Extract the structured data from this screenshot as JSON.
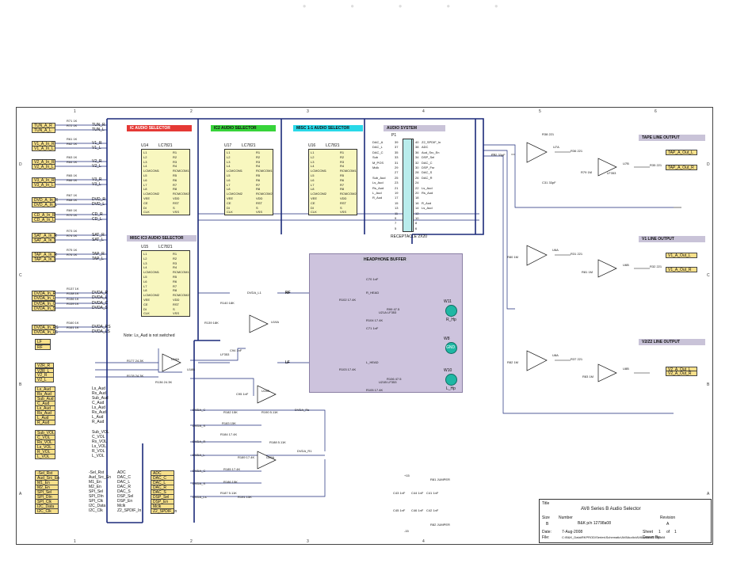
{
  "sheet": {
    "title_block": {
      "title_label": "Title",
      "title": "AV8 Series B Audio Selector",
      "size_label": "Size",
      "size": "B",
      "number_label": "Number",
      "number": "B&K p/n 12798a08",
      "revision_label": "Revision",
      "revision": "A",
      "date_label": "Date:",
      "date": "7-Aug-2008",
      "sheet_label": "Sheet",
      "sheet": "1",
      "of_label": "of",
      "of": "1",
      "file_label": "File:",
      "file": "C:\\B&K_Data\\RKPROD\\Series\\Schematic\\AV8Audio\\AV8Audio\\12798a08",
      "drawn_by_label": "Drawn By:"
    },
    "zones_top": [
      "1",
      "2",
      "3",
      "4",
      "5",
      "6"
    ],
    "zones_side": [
      "D",
      "C",
      "B",
      "A"
    ]
  },
  "blocks": {
    "ic_selector_1": "IC AUDIO SELECTOR",
    "ic_selector_2": "IC2 AUDIO SELECTOR",
    "misc_selector_1": "MISC 1-1 AUDIO SELECTOR",
    "misc_selector_2": "MISC IC3 AUDIO SELECTOR",
    "audio_system": "AUDIO SYSTEM",
    "headphone_buffer": "HEADPHONE BUFFER",
    "receptacle": "RECEPTACLE 2X20",
    "tape_line_output": "TAPE LINE OUTPUT",
    "v1_line_output": "V1 LINE OUTPUT",
    "v222_line_output": "V2/Z2 LINE OUTPUT",
    "note": "Note: Ls_Aud is not switched"
  },
  "chips": {
    "u14": {
      "ref": "U14",
      "part": "LC7821"
    },
    "u17": {
      "ref": "U17",
      "part": "LC7821"
    },
    "u16": {
      "ref": "U16",
      "part": "LC7821"
    },
    "u15": {
      "ref": "U15",
      "part": "LC7821"
    },
    "pin_rows": [
      "L1",
      "L2",
      "L3",
      "L4",
      "LCMCOM1",
      "L5",
      "L6",
      "L7",
      "L8",
      "LCMCOM2",
      "VEE",
      "CE",
      "DI",
      "CLK"
    ],
    "pin_rows_r": [
      "R1",
      "R2",
      "R3",
      "R4",
      "RCMCOM1",
      "R5",
      "R6",
      "R7",
      "R8",
      "RCMCOM2",
      "VDD",
      "RST",
      "S",
      "VSS"
    ]
  },
  "input_ports": [
    "TUN_A_R",
    "TUN_A_L",
    "V1_A_In_R",
    "V1_A_In_L",
    "V2_A_In_R",
    "V2_A_In_L",
    "V3_A_In_R",
    "V3_A_In_L",
    "DVD_A_In_R",
    "DVD_A_In_L",
    "CD_A_In_R",
    "CD_A_In_L",
    "SAT_A_In_R",
    "SAT_A_In_L",
    "TAP_A_In_R",
    "TAP_A_In_L",
    "DVDA_In_R",
    "DVDA_In_L",
    "DVDA_In_C",
    "DVDA_In_S",
    "DVDA_In_RS",
    "DVDA_In_LS"
  ],
  "input_nets": [
    "TUN_R",
    "TUN_L",
    "V1_R",
    "V1_L",
    "V2_R",
    "V2_L",
    "V3_R",
    "V3_L",
    "DVD_R",
    "DVD_L",
    "CD_R",
    "CD_L",
    "SAT_R",
    "SAT_L",
    "TAP_R",
    "TAP_L",
    "DVDA_R",
    "DVDA_L",
    "DVDA_C",
    "DVDA_S",
    "DVDA_RS",
    "DVDA_LS"
  ],
  "resistors_in": [
    "R71 1K",
    "R72 1K",
    "R61 1K",
    "R62 1K",
    "R63 1K",
    "R64 1K",
    "R65 1K",
    "R66 1K",
    "R67 1K",
    "R68 1K",
    "R69 1K",
    "R70 1K",
    "R73 1K",
    "R74 1K",
    "R75 1K",
    "R76 1K",
    "R137 1K",
    "R138 1K",
    "R156 1K",
    "R159 1K",
    "R160 1K",
    "R161 1K"
  ],
  "mid_ports": [
    "V2R_R",
    "V2R_L",
    "V2_R",
    "V2_L"
  ],
  "aud_ports": [
    "Ls_Aud",
    "Rs_Aud",
    "Sub_Aud",
    "C_Aud",
    "Ls_Aud",
    "Rs_Aud",
    "L_Aud",
    "R_Aud"
  ],
  "vol_ports": [
    "Sub_VOL",
    "C_VOL",
    "Rs_VOL",
    "Ls_VOL",
    "R_VOL",
    "L_VOL"
  ],
  "ctrl_ports_l": [
    "-Sel_Rst",
    "Aud_Src_En",
    "M1_En",
    "M2_En",
    "SPI_Sel",
    "SPI_DIn",
    "SPI_Clk",
    "I2C_Data",
    "I2C_Clk"
  ],
  "ctrl_ports_r": [
    "ADC",
    "DAC_C",
    "DAC_L",
    "DAC_R",
    "DAC_S",
    "DSP_Sel",
    "DSP_En",
    "Mclk",
    "Z2_SPDIF_In"
  ],
  "receptacle_pins_l": [
    "DAC_A",
    "DAC_L",
    "DAC_C",
    "Sub",
    "M_POS",
    "Mclk",
    "",
    "Sub_Aud",
    "Ls_Aud",
    "Rs_Aud",
    "L_Aud",
    "R_Aud",
    "",
    "",
    "",
    "",
    "",
    ""
  ],
  "receptacle_pins_r": [
    "Z2_SPDIF_In",
    "ADC",
    "Aud_Src_En",
    "DSP_Sel",
    "DAC_C",
    "DSP_Fsr",
    "DAC_S",
    "DAC_R",
    "",
    "Ls_Aud",
    "Rs_Aud",
    "",
    "R_Aud",
    "Ls_Aud",
    "",
    "",
    "",
    ""
  ],
  "receptacle_nums_l": [
    "39",
    "37",
    "35",
    "33",
    "31",
    "29",
    "27",
    "25",
    "23",
    "21",
    "19",
    "17",
    "15",
    "13",
    "11",
    "9",
    "7",
    "5"
  ],
  "receptacle_nums_r": [
    "40",
    "38",
    "36",
    "34",
    "32",
    "30",
    "28",
    "26",
    "24",
    "22",
    "20",
    "18",
    "16",
    "14",
    "12",
    "10",
    "8",
    "6"
  ],
  "receptacle_ref": "P1",
  "headphone": {
    "hp_r": "R_Hp",
    "hp_l": "L_Hp",
    "gnd": "GND",
    "w11": "W11",
    "w8": "W8",
    "w10": "W10",
    "nets": [
      "RF",
      "LF"
    ],
    "parts": [
      "R102 17.4K",
      "R103 17.4K",
      "R104 17.4K",
      "R105 17.4K",
      "R99 47.5",
      "R106 47.5",
      "U21A LF353",
      "U21B LF353",
      "C71 1nF",
      "C70 1nF",
      "R_HEAD",
      "L_HEAD"
    ]
  },
  "outputs": [
    "TAP_A_Out_L",
    "TAP_A_Out_R",
    "V1_A_Out_L",
    "V1_A_Out_R",
    "V2_A_Out_L",
    "V2_A_Out_R"
  ],
  "output_parts": [
    "U7A",
    "U7B",
    "U6A",
    "U6B",
    "U8A",
    "U8B",
    "LF353",
    "R36 221",
    "R35 221",
    "R31 221",
    "R32 221",
    "R37 221",
    "R38 221",
    "C31 33pF",
    "C32 33pF",
    "R79 1M",
    "R80 1M",
    "R81 1M",
    "R82 1M",
    "R83 1M",
    "R84 1M"
  ],
  "mixer_parts": [
    "R177 24.3K",
    "R178 24.3K",
    "R136 24.3K",
    "U18A",
    "U18B",
    "U19A",
    "U19B",
    "U20A",
    "LF353",
    "R139 18K",
    "R140 18K",
    "C94 1nF",
    "C95 1nF",
    "R182 15K",
    "R183 15K",
    "R184 17.4K",
    "R185 17.4K",
    "R186 15K",
    "R187 5.11K",
    "R188 5.11K",
    "R189 17.4K",
    "R190 5.11K",
    "R191 15K"
  ],
  "mixer_nets": [
    "DVDA_C",
    "DVDA_S",
    "DVDA_R",
    "DVDA_L",
    "DVDA_C",
    "DVDA_S",
    "DVDA_Ls",
    "DVDA_Rs",
    "DVDA_R1",
    "DVDA_L1",
    "RF",
    "LF"
  ],
  "bypass_parts": [
    "C43 1nF",
    "C44 1nF",
    "C45 1nF",
    "C46 1nF",
    "C41 1nF",
    "C42 1nF",
    "R81 JUMPER",
    "R82 JUMPER",
    "+15",
    "-15"
  ],
  "rails": {
    "pos": "+15",
    "neg": "-15"
  }
}
